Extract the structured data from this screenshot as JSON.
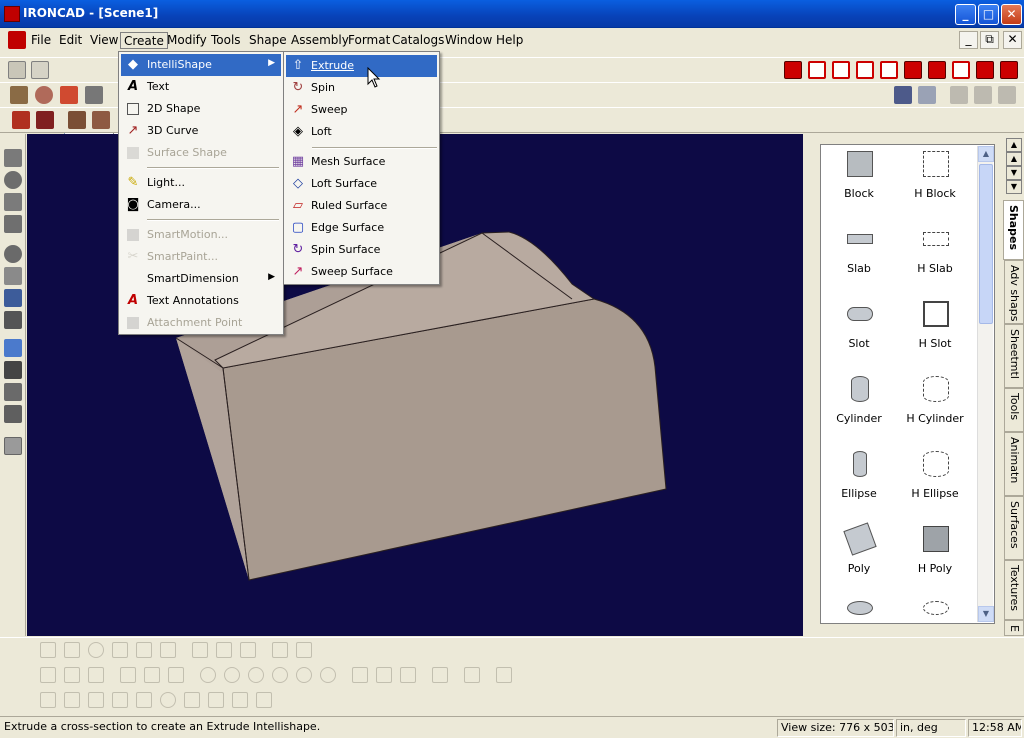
{
  "window": {
    "title": "IRONCAD - [Scene1]",
    "btn_min": "_",
    "btn_max": "□",
    "btn_close": "✕"
  },
  "menubar": {
    "items": [
      "File",
      "Edit",
      "View",
      "Create",
      "Modify",
      "Tools",
      "Shape",
      "Assembly",
      "Format",
      "Catalogs",
      "Window",
      "Help"
    ],
    "mdi_min": "_",
    "mdi_restore": "⧉",
    "mdi_close": "✕"
  },
  "toolbar": {
    "mode_value": "IntelliShape"
  },
  "create_menu": {
    "items": [
      {
        "label": "IntelliShape",
        "icon": "intellishape-icon",
        "state": "highlighted",
        "submenu": true
      },
      {
        "label": "Text",
        "icon": "text-icon",
        "state": "enabled"
      },
      {
        "label": "2D Shape",
        "icon": "2d-shape-icon",
        "state": "enabled"
      },
      {
        "label": "3D Curve",
        "icon": "3d-curve-icon",
        "state": "enabled"
      },
      {
        "label": "Surface Shape",
        "icon": "surface-shape-icon",
        "state": "disabled"
      },
      {
        "label": "Light...",
        "icon": "light-icon",
        "state": "enabled"
      },
      {
        "label": "Camera...",
        "icon": "camera-icon",
        "state": "enabled"
      },
      {
        "label": "SmartMotion...",
        "icon": "smartmotion-icon",
        "state": "disabled"
      },
      {
        "label": "SmartPaint...",
        "icon": "smartpaint-icon",
        "state": "disabled"
      },
      {
        "label": "SmartDimension",
        "icon": "smartdimension-icon",
        "state": "enabled",
        "submenu": true
      },
      {
        "label": "Text Annotations",
        "icon": "text-annotations-icon",
        "state": "enabled"
      },
      {
        "label": "Attachment Point",
        "icon": "attachment-point-icon",
        "state": "disabled"
      }
    ]
  },
  "intellishape_menu": {
    "items": [
      {
        "label": "Extrude",
        "icon": "extrude-icon",
        "state": "highlighted"
      },
      {
        "label": "Spin",
        "icon": "spin-icon"
      },
      {
        "label": "Sweep",
        "icon": "sweep-icon"
      },
      {
        "label": "Loft",
        "icon": "loft-icon"
      },
      {
        "label": "Mesh Surface",
        "icon": "mesh-surface-icon"
      },
      {
        "label": "Loft Surface",
        "icon": "loft-surface-icon"
      },
      {
        "label": "Ruled Surface",
        "icon": "ruled-surface-icon"
      },
      {
        "label": "Edge Surface",
        "icon": "edge-surface-icon"
      },
      {
        "label": "Spin Surface",
        "icon": "spin-surface-icon"
      },
      {
        "label": "Sweep Surface",
        "icon": "sweep-surface-icon"
      }
    ]
  },
  "catalog": {
    "items": [
      "Block",
      "H Block",
      "Slab",
      "H Slab",
      "Slot",
      "H Slot",
      "Cylinder",
      "H Cylinder",
      "Ellipse",
      "H Ellipse",
      "Poly",
      "H Poly"
    ],
    "tabs": [
      "Shapes",
      "Adv shaps",
      "Sheetmtl",
      "Tools",
      "Animatn",
      "Surfaces",
      "Textures",
      "E"
    ]
  },
  "status": {
    "message": "Extrude a cross-section to create an Extrude Intellishape.",
    "view_size": "View size:  776 x  503",
    "units": "in, deg",
    "time": "12:58 AM"
  },
  "colors": {
    "titlebar": "#0842b8",
    "menu_highlight": "#316ac5",
    "viewport_bg": "#0d0a45",
    "part_face": "#a89a8f"
  }
}
